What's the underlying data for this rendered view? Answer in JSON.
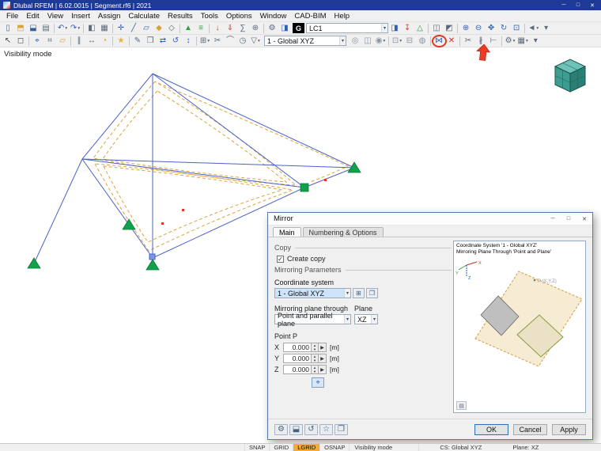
{
  "colors": {
    "titlebar": "#1d3a96",
    "highlight-red": "#e33422",
    "member-blue": "#4a63c8",
    "membrane-orange": "#dfa23c",
    "support-green": "#11a04b",
    "node-red": "#e03428",
    "plane-fill": "#f6ecd4",
    "plane-edge": "#d79b3f",
    "toggle-active": "#f2aa3c",
    "cube-top": "#6fc3b6",
    "cube-left": "#3f9c90",
    "cube-right": "#2b7e74"
  },
  "window": {
    "title": "Dlubal RFEM | 6.02.0015 | Segment.rf6 | 2021",
    "controls": {
      "minimize": "─",
      "maximize": "□",
      "close": "✕"
    }
  },
  "menu": {
    "items": [
      "File",
      "Edit",
      "View",
      "Insert",
      "Assign",
      "Calculate",
      "Results",
      "Tools",
      "Options",
      "Window",
      "CAD-BIM",
      "Help"
    ]
  },
  "toolbar1": {
    "loadcase_g": "G",
    "loadcase_value": "LC1",
    "left": [
      {
        "name": "new-model-button",
        "icon": "new-file-icon",
        "glyph": "▯",
        "color": "#5a6a7a"
      },
      {
        "name": "open-model-button",
        "icon": "open-folder-icon",
        "glyph": "⬒",
        "color": "#d8a23a"
      },
      {
        "name": "save-model-button",
        "icon": "save-icon",
        "glyph": "⬓",
        "color": "#3a5f9e"
      },
      {
        "name": "print-button",
        "icon": "printer-icon",
        "glyph": "▤",
        "color": "#5a6a7a"
      },
      {
        "sep": true
      },
      {
        "name": "undo-button",
        "icon": "undo-icon",
        "glyph": "↶",
        "color": "#2e5fb8",
        "dd": true
      },
      {
        "name": "redo-button",
        "icon": "redo-icon",
        "glyph": "↷",
        "color": "#2e5fb8",
        "dd": true
      },
      {
        "sep": true
      },
      {
        "name": "navigator-toggle-button",
        "icon": "panel-icon",
        "glyph": "◧",
        "color": "#5a6a7a"
      },
      {
        "name": "tables-toggle-button",
        "icon": "table-icon",
        "glyph": "▦",
        "color": "#5a6a7a"
      },
      {
        "sep": true
      },
      {
        "name": "insert-node-button",
        "icon": "node-icon",
        "glyph": "✛",
        "color": "#2e5fb8"
      },
      {
        "name": "insert-line-button",
        "icon": "line-icon",
        "glyph": "╱",
        "color": "#2e5fb8"
      },
      {
        "name": "insert-member-button",
        "icon": "member-icon",
        "glyph": "▱",
        "color": "#2e5fb8"
      },
      {
        "name": "insert-surface-button",
        "icon": "surface-icon",
        "glyph": "◆",
        "color": "#d8a23a"
      },
      {
        "name": "insert-solid-button",
        "icon": "solid-icon",
        "glyph": "◇",
        "color": "#5a6a7a"
      },
      {
        "sep": true
      },
      {
        "name": "nodal-support-button",
        "icon": "support-icon",
        "glyph": "▲",
        "color": "#2f9e44"
      },
      {
        "name": "line-support-button",
        "icon": "line-support-icon",
        "glyph": "≡",
        "color": "#2f9e44"
      },
      {
        "sep": true
      },
      {
        "name": "nodal-load-button",
        "icon": "load-arrow-icon",
        "glyph": "↓",
        "color": "#d83a2e"
      },
      {
        "name": "member-load-button",
        "icon": "member-load-icon",
        "glyph": "⇓",
        "color": "#d83a2e"
      },
      {
        "name": "load-cases-button",
        "icon": "sigma-icon",
        "glyph": "∑",
        "color": "#5a6a7a"
      },
      {
        "name": "combinations-button",
        "icon": "combination-icon",
        "glyph": "⊕",
        "color": "#5a6a7a"
      },
      {
        "sep": true
      },
      {
        "name": "calculate-button",
        "icon": "gear-icon",
        "glyph": "⚙",
        "color": "#5a6a7a"
      },
      {
        "name": "results-button",
        "icon": "results-icon",
        "glyph": "◨",
        "color": "#2e5fb8"
      }
    ],
    "right": [
      {
        "name": "show-results-button",
        "icon": "results-display-icon",
        "glyph": "◨",
        "color": "#2e5fb8"
      },
      {
        "name": "show-loads-button",
        "icon": "loads-display-icon",
        "glyph": "↧",
        "color": "#d83a2e"
      },
      {
        "name": "show-supports-button",
        "icon": "supports-display-icon",
        "glyph": "△",
        "color": "#2f9e44"
      },
      {
        "sep": true
      },
      {
        "name": "wireframe-view-button",
        "icon": "wireframe-icon",
        "glyph": "◫",
        "color": "#5a6a7a"
      },
      {
        "name": "solid-view-button",
        "icon": "solid-view-icon",
        "glyph": "◩",
        "color": "#5a6a7a"
      },
      {
        "sep": true
      },
      {
        "name": "zoom-in-button",
        "icon": "zoom-in-icon",
        "glyph": "⊕",
        "color": "#2e5fb8"
      },
      {
        "name": "zoom-out-button",
        "icon": "zoom-out-icon",
        "glyph": "⊖",
        "color": "#2e5fb8"
      },
      {
        "name": "pan-view-button",
        "icon": "pan-icon",
        "glyph": "✥",
        "color": "#2e5fb8"
      },
      {
        "name": "rotate-view-button",
        "icon": "orbit-icon",
        "glyph": "↻",
        "color": "#2e5fb8"
      },
      {
        "name": "zoom-extents-button",
        "icon": "fit-view-icon",
        "glyph": "⊡",
        "color": "#2e5fb8"
      },
      {
        "sep": true
      },
      {
        "name": "previous-view-button",
        "icon": "prev-view-icon",
        "glyph": "◄",
        "color": "#5a6a7a",
        "dd": true
      },
      {
        "name": "more-views-button",
        "icon": "chevron-down-icon",
        "glyph": "▾",
        "color": "#5a6a7a"
      }
    ]
  },
  "toolbar2": {
    "coord_value": "1 - Global XYZ",
    "left": [
      {
        "name": "select-pointer-button",
        "icon": "cursor-icon",
        "glyph": "↖",
        "color": "#444444"
      },
      {
        "name": "select-window-button",
        "icon": "selection-box-icon",
        "glyph": "◻",
        "color": "#444444"
      },
      {
        "sep": true
      },
      {
        "name": "snap-button",
        "icon": "snap-icon",
        "glyph": "⌖",
        "color": "#2e5fb8"
      },
      {
        "name": "grid-button",
        "icon": "grid-icon",
        "glyph": "⌗",
        "color": "#5a6a7a"
      },
      {
        "name": "work-plane-button",
        "icon": "plane-icon",
        "glyph": "▱",
        "color": "#d8a23a"
      },
      {
        "sep": true
      },
      {
        "name": "guidelines-button",
        "icon": "guideline-icon",
        "glyph": "∥",
        "color": "#5a6a7a"
      },
      {
        "name": "dimension-button",
        "icon": "dimension-icon",
        "glyph": "↔",
        "color": "#5a6a7a"
      },
      {
        "name": "comment-button",
        "icon": "comment-icon",
        "glyph": "◔",
        "color": "#d8a23a"
      },
      {
        "sep": true
      },
      {
        "name": "visual-objects-button",
        "icon": "star-icon",
        "glyph": "★",
        "color": "#e2b33c"
      },
      {
        "sep": true
      },
      {
        "name": "edit-objects-button",
        "icon": "pencil-icon",
        "glyph": "✎",
        "color": "#5a6a7a"
      },
      {
        "name": "copy-objects-button",
        "icon": "copy-icon",
        "glyph": "❐",
        "color": "#5a6a7a"
      },
      {
        "name": "move-objects-button",
        "icon": "move-icon",
        "glyph": "⇄",
        "color": "#2e5fb8"
      },
      {
        "name": "rotate-objects-button",
        "icon": "rotate-icon",
        "glyph": "↺",
        "color": "#2e5fb8"
      },
      {
        "name": "scale-objects-button",
        "icon": "scale-icon",
        "glyph": "↕",
        "color": "#2e5fb8"
      },
      {
        "sep": true
      },
      {
        "name": "line-grid-button",
        "icon": "line-grid-icon",
        "glyph": "⊞",
        "color": "#5a6a7a",
        "dd": true
      },
      {
        "name": "section-cut-button",
        "icon": "scissors-icon",
        "glyph": "✂",
        "color": "#5a6a7a"
      },
      {
        "name": "measure-button",
        "icon": "arc-icon",
        "glyph": "⌒",
        "color": "#5a6a7a"
      },
      {
        "name": "history-button",
        "icon": "clock-icon",
        "glyph": "◷",
        "color": "#5a6a7a"
      },
      {
        "name": "filter-button",
        "icon": "funnel-icon",
        "glyph": "▽",
        "color": "#5a6a7a",
        "dd": true
      }
    ],
    "mid": [
      {
        "name": "display-properties-button",
        "icon": "display-icon",
        "glyph": "◎",
        "color": "#8a949e"
      },
      {
        "name": "clipping-box-button",
        "icon": "clip-icon",
        "glyph": "◫",
        "color": "#8a949e"
      },
      {
        "name": "visibility-modes-button",
        "icon": "visibility-icon",
        "glyph": "◉",
        "color": "#8a949e",
        "dd": true
      },
      {
        "sep": true
      },
      {
        "name": "select-filter-button",
        "icon": "select-filter-icon",
        "glyph": "⊡",
        "color": "#8a949e",
        "dd": true
      },
      {
        "name": "deselect-button",
        "icon": "deselect-icon",
        "glyph": "⊟",
        "color": "#8a949e"
      },
      {
        "name": "user-view-button",
        "icon": "camera-icon",
        "glyph": "◍",
        "color": "#8a949e"
      },
      {
        "sep": true
      }
    ],
    "right": [
      {
        "name": "mirror-objects-button",
        "icon": "mirror-icon",
        "glyph": "⋈",
        "color": "#2e5fb8",
        "highlight": true
      },
      {
        "name": "delete-objects-button",
        "icon": "delete-icon",
        "glyph": "✕",
        "color": "#d42b1e"
      },
      {
        "sep": true
      },
      {
        "name": "trim-lines-button",
        "icon": "trim-icon",
        "glyph": "✂",
        "color": "#5a6a7a"
      },
      {
        "name": "divide-lines-button",
        "icon": "divide-icon",
        "glyph": "∦",
        "color": "#5a6a7a"
      },
      {
        "name": "connect-lines-button",
        "icon": "connect-icon",
        "glyph": "⊢",
        "color": "#5a6a7a"
      },
      {
        "sep": true
      },
      {
        "name": "settings-button",
        "icon": "gear-icon",
        "glyph": "⚙",
        "color": "#5a6a7a",
        "dd": true
      },
      {
        "name": "result-tables-button",
        "icon": "table-icon",
        "glyph": "▦",
        "color": "#5a6a7a",
        "dd": true
      },
      {
        "name": "more-tools-button",
        "icon": "chevron-down-icon",
        "glyph": "▾",
        "color": "#5a6a7a"
      }
    ]
  },
  "canvas": {
    "mode_label": "Visibility mode"
  },
  "dialog": {
    "title": "Mirror",
    "tabs": [
      {
        "label": "Main",
        "active": true
      },
      {
        "label": "Numbering & Options",
        "active": false
      }
    ],
    "copy_group": "Copy",
    "create_copy_label": "Create copy",
    "create_copy_checked": true,
    "checkbox_checked_glyph": "✓",
    "params_group": "Mirroring Parameters",
    "coordinate_system_label": "Coordinate system",
    "coordinate_system_value": "1 - Global XYZ",
    "mirror_plane_label": "Mirroring plane through",
    "mirror_plane_value": "Point and parallel plane",
    "plane_label": "Plane",
    "plane_value": "XZ",
    "point_label": "Point P",
    "point_rows": [
      {
        "axis": "X",
        "value": "0.000",
        "unit": "[m]"
      },
      {
        "axis": "Y",
        "value": "0.000",
        "unit": "[m]"
      },
      {
        "axis": "Z",
        "value": "0.000",
        "unit": "[m]"
      }
    ],
    "preview": {
      "line1": "Coordinate System '1 - Global XYZ'",
      "line2": "Mirroring Plane Through 'Point and Plane'",
      "point_label": "P (X,Y,Z)",
      "axis_x": "X",
      "axis_y": "Y",
      "axis_z": "Z"
    },
    "tool_buttons": [
      {
        "name": "dialog-settings-button",
        "icon": "gear-icon",
        "glyph": "⚙",
        "color": "#44617e"
      },
      {
        "name": "save-defaults-button",
        "icon": "save-icon",
        "glyph": "⬓",
        "color": "#44617e"
      },
      {
        "name": "restore-defaults-button",
        "icon": "undo-icon",
        "glyph": "↺",
        "color": "#44617e"
      },
      {
        "name": "favorites-button",
        "icon": "star-icon",
        "glyph": "☆",
        "color": "#44617e"
      },
      {
        "name": "copy-settings-button",
        "icon": "copy-icon",
        "glyph": "❐",
        "color": "#44617e"
      }
    ],
    "ok": "OK",
    "cancel": "Cancel",
    "apply": "Apply"
  },
  "statusbar": {
    "toggles": [
      {
        "label": "SNAP",
        "active": false
      },
      {
        "label": "GRID",
        "active": false
      },
      {
        "label": "LGRID",
        "active": true
      },
      {
        "label": "OSNAP",
        "active": false
      }
    ],
    "mode": "Visibility mode",
    "cs": "CS: Global XYZ",
    "plane": "Plane: XZ"
  }
}
